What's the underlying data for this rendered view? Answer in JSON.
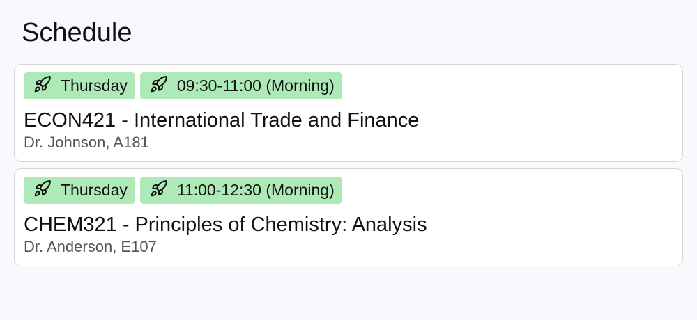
{
  "page": {
    "title": "Schedule"
  },
  "schedule": [
    {
      "day": "Thursday",
      "time": "09:30-11:00 (Morning)",
      "course": "ECON421 - International Trade and Finance",
      "details": "Dr. Johnson, A181",
      "chip_icon": "rocket-icon"
    },
    {
      "day": "Thursday",
      "time": "11:00-12:30 (Morning)",
      "course": "CHEM321 - Principles of Chemistry: Analysis",
      "details": "Dr. Anderson, E107",
      "chip_icon": "rocket-icon"
    }
  ],
  "colors": {
    "background": "#f8f9fc",
    "card": "#ffffff",
    "card_border": "#d6d6d6",
    "chip": "#aee9b8",
    "text": "#111111",
    "muted_text": "#555555"
  }
}
